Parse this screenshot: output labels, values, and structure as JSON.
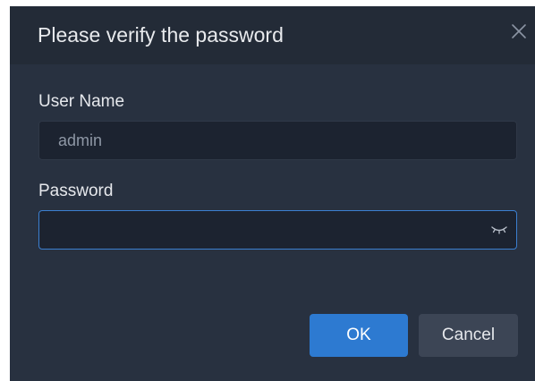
{
  "dialog": {
    "title": "Please verify the password",
    "close_icon": "close-icon"
  },
  "form": {
    "username_label": "User Name",
    "username_value": "admin",
    "password_label": "Password",
    "password_value": "",
    "password_toggle_icon": "eye-closed-icon"
  },
  "buttons": {
    "ok_label": "OK",
    "cancel_label": "Cancel"
  },
  "colors": {
    "dialog_background": "#283140",
    "header_background": "#232b37",
    "input_background": "#1c2330",
    "focus_border": "#3b7fd0",
    "primary_button": "#2d7ad1",
    "secondary_button": "#3c4555"
  }
}
